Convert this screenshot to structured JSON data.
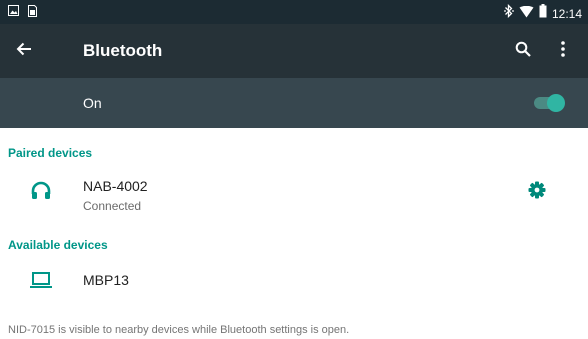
{
  "status_bar": {
    "left_icons": [
      "image-notification-icon",
      "sim-storage-icon"
    ],
    "right_icons": [
      "bluetooth-icon",
      "wifi-icon",
      "battery-icon"
    ],
    "time": "12:14"
  },
  "toolbar": {
    "back_icon": "arrow-left-icon",
    "title": "Bluetooth",
    "search_icon": "search-icon",
    "more_icon": "more-vert-icon"
  },
  "bluetooth_switch": {
    "label": "On",
    "enabled": true
  },
  "paired_section": {
    "header": "Paired devices",
    "devices": [
      {
        "icon": "headphones-icon",
        "name": "NAB-4002",
        "status": "Connected",
        "settings_icon": "gear-icon"
      }
    ]
  },
  "available_section": {
    "header": "Available devices",
    "devices": [
      {
        "icon": "laptop-icon",
        "name": "MBP13"
      }
    ]
  },
  "footer_note": "NID-7015 is visible to nearby devices while Bluetooth settings is open.",
  "colors": {
    "status_bar": "#1c2b33",
    "toolbar": "#263238",
    "switch_bar": "#37474f",
    "accent": "#009688",
    "toggle_thumb": "#30b5a3"
  }
}
